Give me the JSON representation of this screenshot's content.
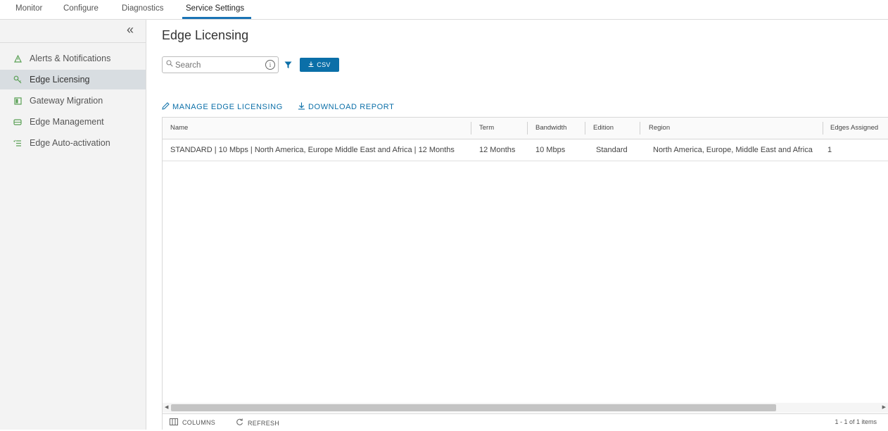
{
  "topnav": {
    "tabs": [
      {
        "label": "Monitor"
      },
      {
        "label": "Configure"
      },
      {
        "label": "Diagnostics"
      },
      {
        "label": "Service Settings",
        "active": true
      }
    ]
  },
  "sidebar": {
    "collapse_glyph": "«",
    "items": [
      {
        "label": "Alerts & Notifications",
        "icon": "warning-triangle-icon"
      },
      {
        "label": "Edge Licensing",
        "icon": "key-icon",
        "active": true
      },
      {
        "label": "Gateway Migration",
        "icon": "migration-icon"
      },
      {
        "label": "Edge Management",
        "icon": "edge-device-icon"
      },
      {
        "label": "Edge Auto-activation",
        "icon": "list-check-icon"
      }
    ]
  },
  "main": {
    "title": "Edge Licensing",
    "search": {
      "placeholder": "Search",
      "value": ""
    },
    "csv_label": "CSV",
    "actions": {
      "manage": "MANAGE EDGE LICENSING",
      "download": "DOWNLOAD REPORT"
    }
  },
  "grid": {
    "columns": [
      "Name",
      "Term",
      "Bandwidth",
      "Edition",
      "Region",
      "Edges Assigned"
    ],
    "rows": [
      {
        "name": "STANDARD | 10 Mbps | North America, Europe Middle East and Africa | 12 Months",
        "term": "12 Months",
        "bandwidth": "10 Mbps",
        "edition": "Standard",
        "region": "North America, Europe, Middle East and Africa",
        "edges_assigned": "1"
      }
    ],
    "footer": {
      "columns_label": "COLUMNS",
      "refresh_label": "REFRESH",
      "count_text": "1 - 1 of 1 items"
    }
  },
  "colors": {
    "accent": "#0b6fa8",
    "tab_underline": "#1a73b5",
    "sidebar_bg": "#f3f3f3",
    "sidebar_active": "#d8dde1",
    "icon_green": "#5aa055"
  }
}
